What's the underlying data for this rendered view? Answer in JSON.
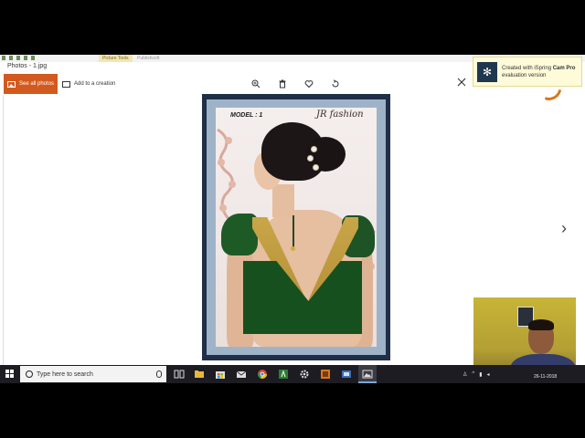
{
  "ribbon": {
    "contextual_tab": "Picture Tools",
    "faded_tab": "Publishsoft"
  },
  "window": {
    "title": "Photos - 1.jpg"
  },
  "toolbar": {
    "see_all_photos": "See all photos",
    "add_to_creation": "Add to a creation",
    "icons": [
      "zoom-in-icon",
      "delete-icon",
      "heart-icon",
      "rotate-icon",
      "edit-icon"
    ]
  },
  "notification": {
    "line1_prefix": "Created with iSpring ",
    "line1_bold": "Cam Pro",
    "line2": "evaluation version"
  },
  "image": {
    "model_label": "MODEL : 1",
    "brand": "JR fashion",
    "colors": {
      "frame": "#1f2f48",
      "mat": "#9fb3c8",
      "blouse": "#17501f",
      "gold": "#c9a648"
    }
  },
  "taskbar": {
    "search_placeholder": "Type here to search",
    "date": "26-11-2018"
  },
  "colors": {
    "accent": "#d35a1f",
    "taskbar": "#1c1c22"
  }
}
